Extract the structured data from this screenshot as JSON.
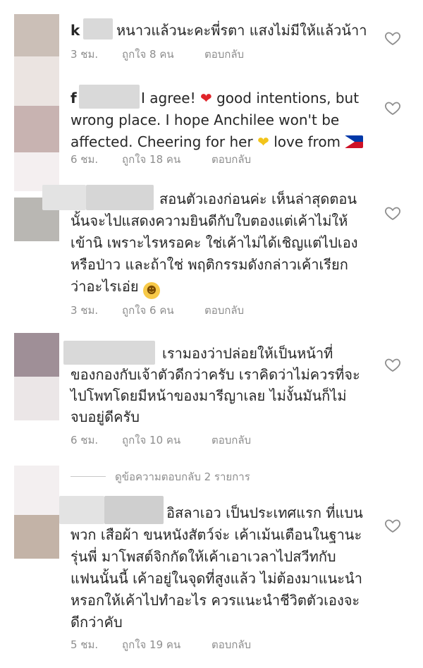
{
  "colors": {
    "text": "#262626",
    "meta": "#8e8e8e",
    "heart_icon": "#8e8e8e",
    "blur": "#d9d9d9"
  },
  "comments": [
    {
      "text_lines": [
        "หนาวแล้วนะคะพี่รตา แสงไม่มีให้แล้วน้าา"
      ],
      "visible_username": "k",
      "time": "3 ชม.",
      "likes": "ถูกใจ 8 คน",
      "reply": "ตอบกลับ"
    },
    {
      "text_lines": [
        "I agree!",
        "good intentions, but",
        "wrong place. I hope Anchilee won't be",
        "affected. Cheering for her",
        "love from"
      ],
      "visible_username": "f",
      "emoji_heart": "❤",
      "emoji_yellow_heart": "❤",
      "time": "6 ชม.",
      "likes": "ถูกใจ 18 คน",
      "reply": "ตอบกลับ"
    },
    {
      "text_lines": [
        "สอนตัวเองก่อนค่ะ เห็นล่าสุดตอน",
        "นั้นจะไปแสดงความยินดีกับใบตองแต่เค้าไม่ให้",
        "เข้านิ เพราะไรหรอคะ ใช่เค้าไม่ได้เชิญแต่ไปเอง",
        "หรือป่าว และถ้าใช่ พฤติกรรมดังกล่าวเค้าเรียก",
        "ว่าอะไรเอ่ย"
      ],
      "emoji_laugh": "😂",
      "time": "3 ชม.",
      "likes": "ถูกใจ 6 คน",
      "reply": "ตอบกลับ"
    },
    {
      "text_lines": [
        "เรามองว่าปล่อยให้เป็นหน้าที่",
        "ของกองกับเจ้าตัวดีกว่าครับ เราคิดว่าไม่ควรที่จะ",
        "ไปโพทโดยมีหน้าของมารีญาเลย ไม่งั้นมันก็ไม่",
        "จบอยู่ดีครับ"
      ],
      "time": "6 ชม.",
      "likes": "ถูกใจ 10 คน",
      "reply": "ตอบกลับ"
    },
    {
      "text_lines": [
        "อิสลาเอว เป็นประเทศแรก ที่แบน",
        "พวก เสือผ้า ขนหนังสัตว์จ่ะ เค้าเม้นเตือนในฐานะ",
        "รุ่นพี่ มาโพสต์จิกกัดให้เค้าเอาเวลาไปสวีทกับ",
        "แฟนนั้นนี้ เค้าอยู่ในจุดที่สูงแล้ว  ไม่ต้องมาแนะนำ",
        "หรอกให้เค้าไปทำอะไร ควรแนะนำชีวิตตัวเองจะ",
        "ดีกว่าคับ"
      ],
      "time": "5 ชม.",
      "likes": "ถูกใจ 19 คน",
      "reply": "ตอบกลับ"
    }
  ],
  "view_replies": "ดูข้อความตอบกลับ 2 รายการ"
}
